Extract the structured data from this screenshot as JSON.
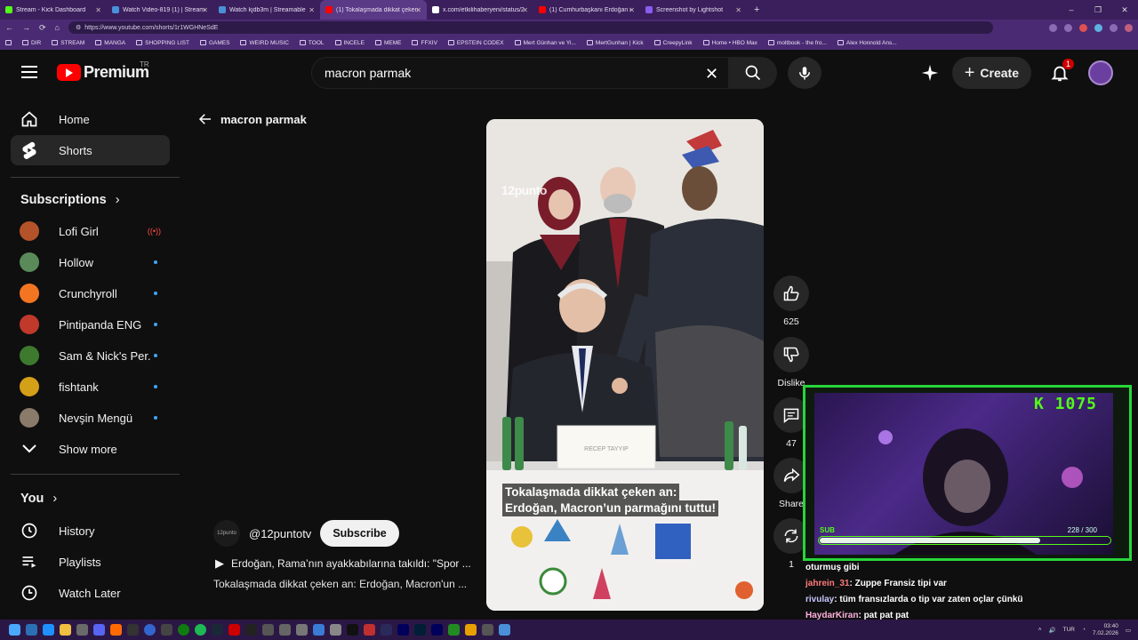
{
  "browser": {
    "tabs": [
      {
        "label": "Stream - Kick Dashboard",
        "color": "#53fc18"
      },
      {
        "label": "Watch Video-819 (1) | Streamable",
        "color": "#4a90d9"
      },
      {
        "label": "Watch kjdb3m | Streamable",
        "color": "#4a90d9"
      },
      {
        "label": "(1) Tokalaşmada dikkat çeken",
        "color": "#ff0000",
        "active": true
      },
      {
        "label": "x.com/etkilihaberyeni/status/2017...",
        "color": "#ffffff"
      },
      {
        "label": "(1) Cumhurbaşkanı Erdoğan ile Fr...",
        "color": "#ff0000"
      },
      {
        "label": "Screenshot by Lightshot",
        "color": "#8a5cf0"
      }
    ],
    "new_tab": "+",
    "window_controls": [
      "–",
      "❐",
      "✕"
    ],
    "url": "https://www.youtube.com/shorts/1r1WGHNeSdE",
    "bookmarks": [
      "DIR",
      "STREAM",
      "MANGA",
      "SHOPPING LIST",
      "GAMES",
      "WEIRD MUSIC",
      "TOOL",
      "INCELE",
      "MEME",
      "FFXIV",
      "EPSTEIN CODEX",
      "Mert Günhan ve Yi...",
      "MertGunhan | Kick",
      "CreepyLink",
      "Home • HBO Max",
      "moltbook - the fro...",
      "Alex Honnold Ans..."
    ]
  },
  "header": {
    "logo_word": "Premium",
    "logo_region": "TR",
    "search_value": "macron parmak",
    "create_label": "Create",
    "notification_count": "1"
  },
  "sidebar": {
    "home": "Home",
    "shorts": "Shorts",
    "subscriptions_title": "Subscriptions",
    "subscriptions": [
      {
        "name": "Lofi Girl",
        "color": "#b4532a",
        "live": true
      },
      {
        "name": "Hollow",
        "color": "#5a8a5a"
      },
      {
        "name": "Crunchyroll",
        "color": "#f47521"
      },
      {
        "name": "Pintipanda ENG",
        "color": "#c0392b"
      },
      {
        "name": "Sam & Nick's Per...",
        "color": "#3d7a2e"
      },
      {
        "name": "fishtank",
        "color": "#d4a017"
      },
      {
        "name": "Nevşin Mengü",
        "color": "#8a7a6a"
      }
    ],
    "show_more": "Show more",
    "you_title": "You",
    "you_items": [
      "History",
      "Playlists",
      "Watch Later"
    ]
  },
  "main": {
    "back_title": "macron parmak",
    "video": {
      "watermark": "12punto",
      "caption_line1": "Tokalaşmada dikkat çeken an:",
      "caption_line2": "Erdoğan, Macron’un parmağını tuttu!",
      "nameplate": "RECEP TAYYIP"
    },
    "actions": {
      "likes": "625",
      "dislike": "Dislike",
      "comments": "47",
      "share": "Share",
      "remix": "1"
    },
    "channel": {
      "avatar_text": "12punto",
      "handle": "@12puntotv",
      "subscribe": "Subscribe"
    },
    "desc_line1": "Erdoğan, Rama’nın ayakkabılarına takıldı: \"Spor ...",
    "desc_line2": "Tokalaşmada dikkat çeken an: Erdoğan, Macron'un ..."
  },
  "stream_overlay": {
    "kick_count": "K 1075",
    "sub_label": "SUB",
    "sub_progress": "228  /  300",
    "sub_fraction": 0.76
  },
  "chat": [
    {
      "user": "",
      "message": "oturmuş gibi"
    },
    {
      "user": "jahrein_31",
      "message": ": Zuppe Fransiz tipi var"
    },
    {
      "user": "rivulay",
      "message": ": tüm fransızlarda o tip var zaten oçlar çünkü"
    },
    {
      "user": "HaydarKiran",
      "message": ": pat pat pat"
    }
  ],
  "taskbar": {
    "lang": "TUR",
    "time": "03:40",
    "date": "7.02.2026"
  },
  "colors": {
    "yt_red": "#ff0000",
    "kick_green": "#53fc18",
    "browser_purple": "#4a2b73"
  }
}
